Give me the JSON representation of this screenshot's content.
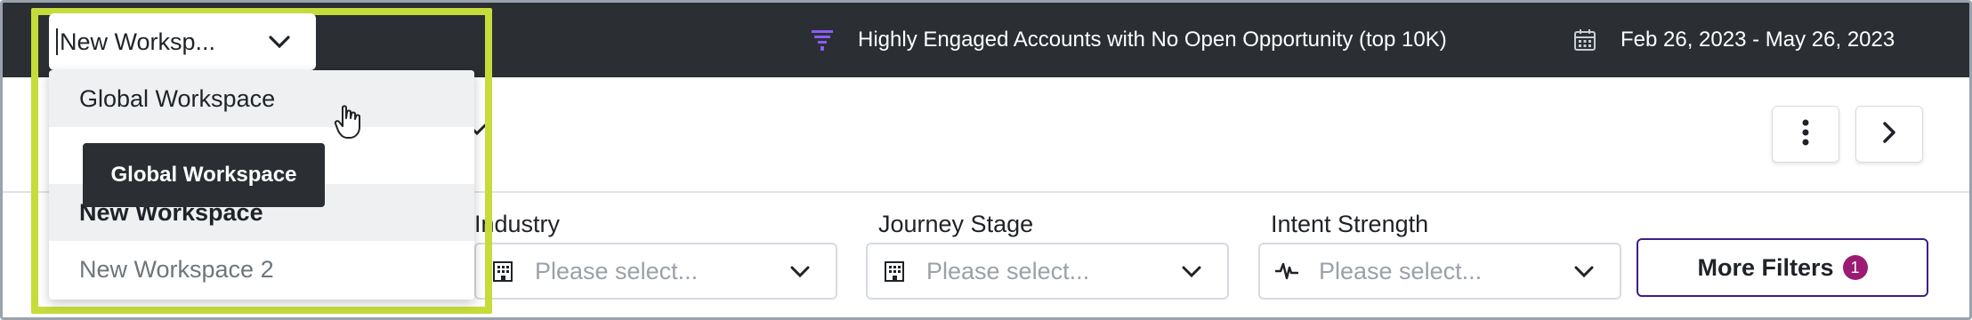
{
  "topbar": {
    "segment": "Highly Engaged Accounts with No Open Opportunity (top 10K)",
    "date_range": "Feb 26, 2023 - May 26, 2023"
  },
  "workspace": {
    "current_value": "New Worksp...",
    "options": [
      "Global Workspace",
      "",
      "New Workspace",
      "New Workspace 2"
    ],
    "tooltip": "Global Workspace"
  },
  "filters": [
    {
      "label": "Industry",
      "placeholder": "Please select...",
      "icon": "building-icon"
    },
    {
      "label": "Journey Stage",
      "placeholder": "Please select...",
      "icon": "building-icon"
    },
    {
      "label": "Intent Strength",
      "placeholder": "Please select...",
      "icon": "pulse-icon"
    }
  ],
  "more_filters": {
    "label": "More Filters",
    "count": "1"
  },
  "colors": {
    "topbar_bg": "#2b2f34",
    "highlight": "#c5dc3a",
    "funnel": "#8b5cf6",
    "more_border": "#3f1d8a",
    "badge": "#9b1b73"
  }
}
